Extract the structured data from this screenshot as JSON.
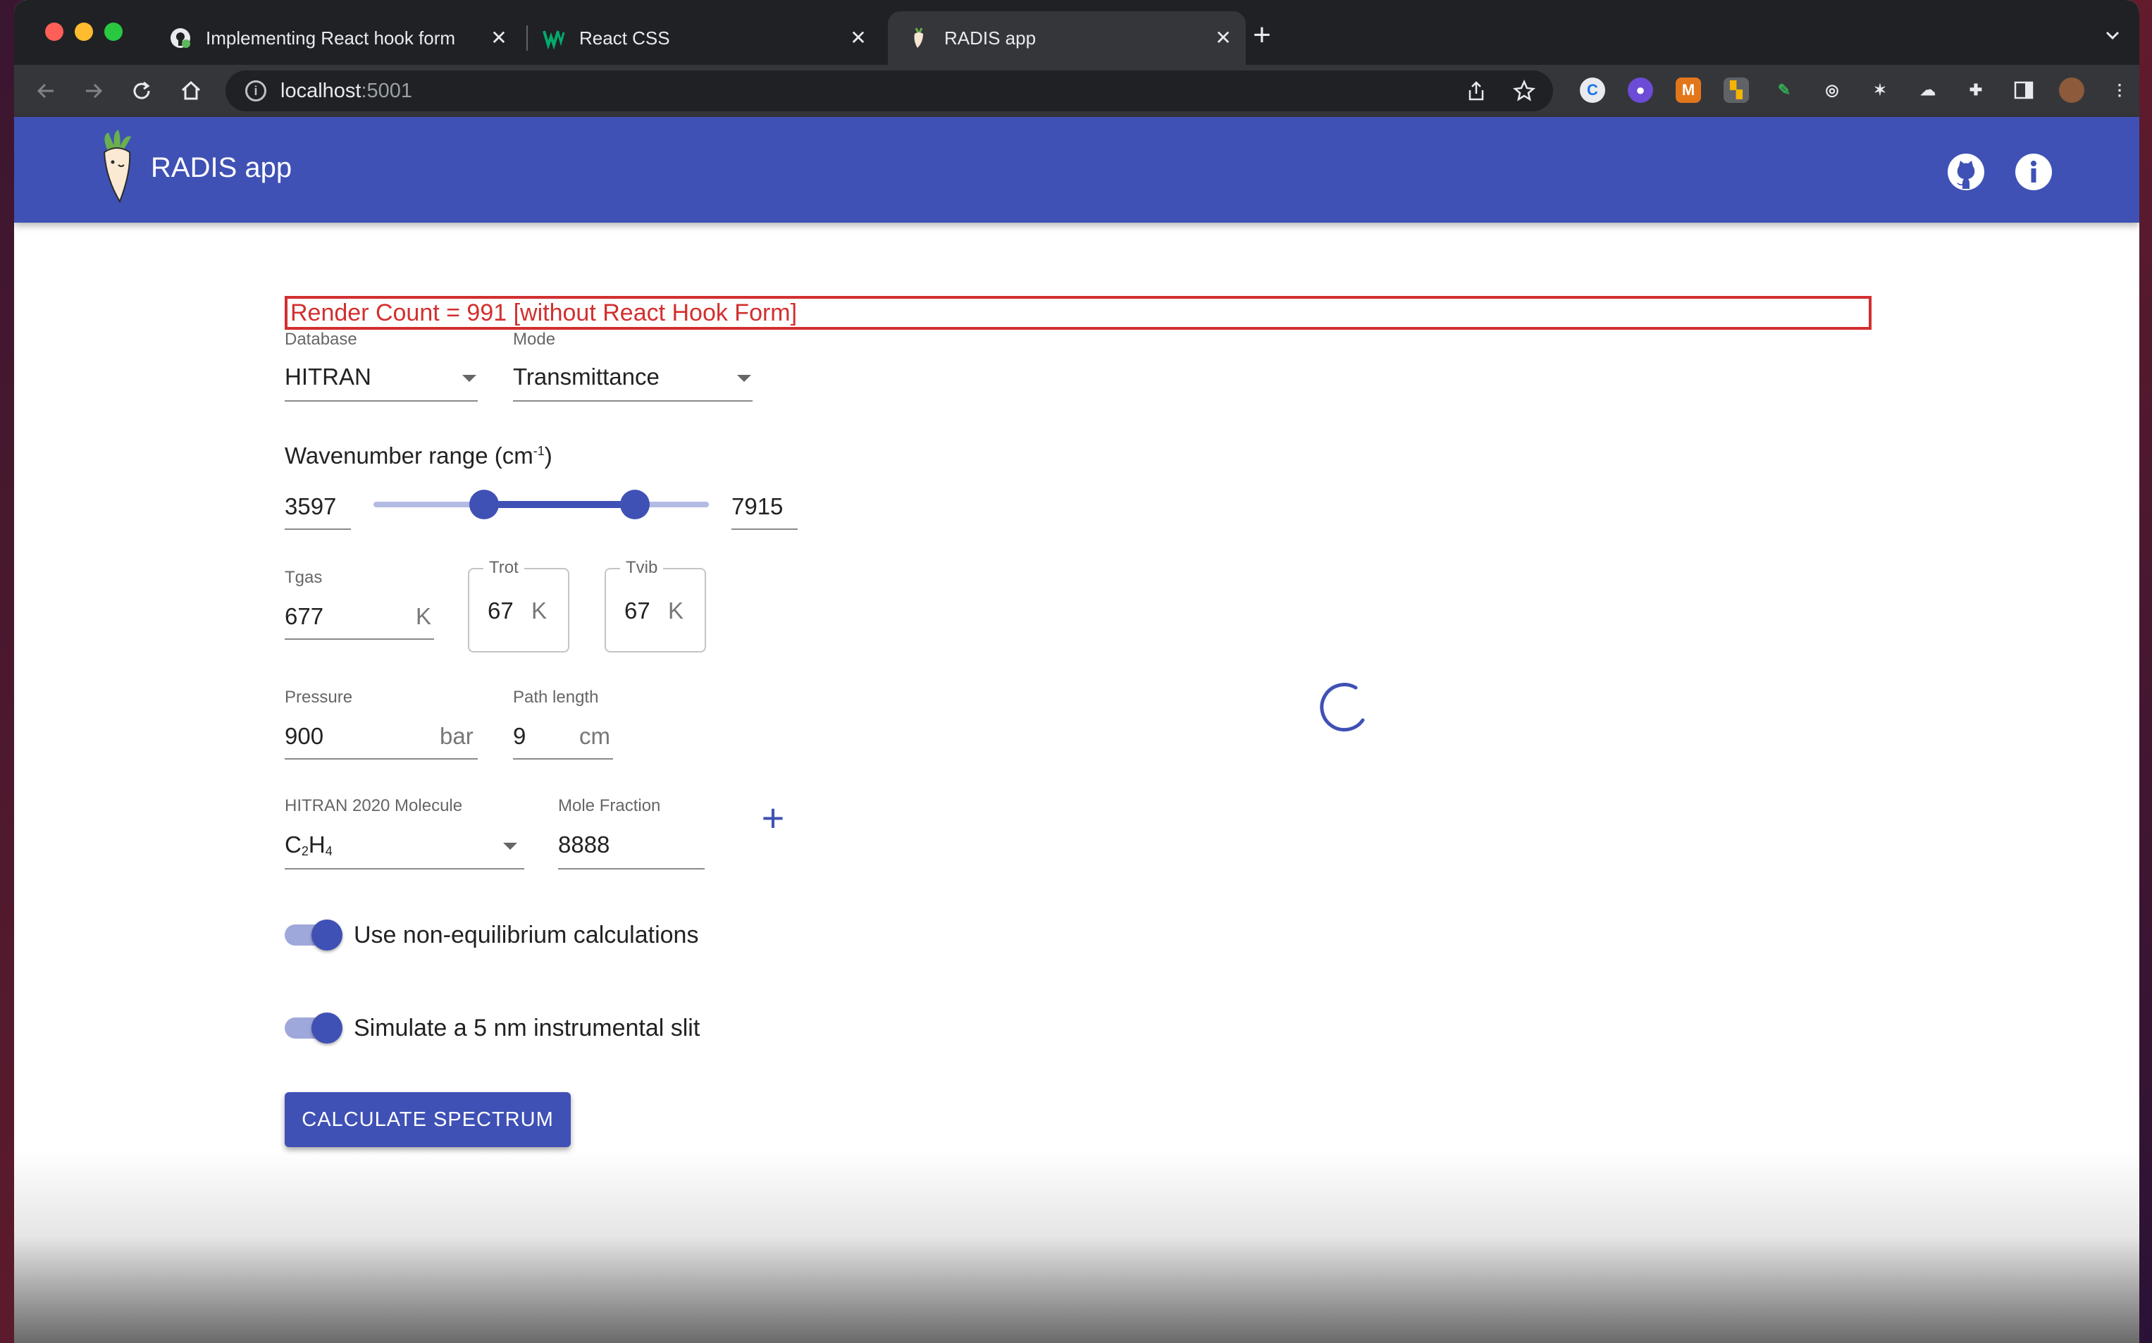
{
  "browser": {
    "tabs": [
      {
        "title": "Implementing React hook form",
        "favicon": "github-icon",
        "active": false
      },
      {
        "title": "React CSS",
        "favicon": "w3schools-icon",
        "active": false
      },
      {
        "title": "RADIS app",
        "favicon": "radish-icon",
        "active": true
      }
    ],
    "url_host": "localhost",
    "url_port": ":5001"
  },
  "app": {
    "title": "RADIS app",
    "header_icons": [
      "github-icon",
      "info-icon"
    ]
  },
  "render_count": "Render Count = 991 [without React Hook Form]",
  "database": {
    "label": "Database",
    "value": "HITRAN"
  },
  "mode": {
    "label": "Mode",
    "value": "Transmittance"
  },
  "wavenumber": {
    "title_prefix": "Wavenumber range (cm",
    "title_sup": "-1",
    "title_suffix": ")",
    "min": "3597",
    "max": "7915",
    "slider_low_fraction": 0.33,
    "slider_high_fraction": 0.78
  },
  "tgas": {
    "label": "Tgas",
    "value": "677",
    "unit": "K"
  },
  "trot": {
    "label": "Trot",
    "value": "67",
    "unit": "K"
  },
  "tvib": {
    "label": "Tvib",
    "value": "67",
    "unit": "K"
  },
  "pressure": {
    "label": "Pressure",
    "value": "900",
    "unit": "bar"
  },
  "path_length": {
    "label": "Path length",
    "value": "9",
    "unit": "cm"
  },
  "molecule": {
    "label": "HITRAN 2020 Molecule",
    "value_c": "C",
    "value_sub1": "2",
    "value_h": "H",
    "value_sub2": "4"
  },
  "mole_fraction": {
    "label": "Mole Fraction",
    "value": "8888"
  },
  "switches": {
    "non_equilibrium": {
      "label": "Use non-equilibrium calculations",
      "on": true
    },
    "slit": {
      "label": "Simulate a 5 nm instrumental slit",
      "on": true
    }
  },
  "calculate_button": "CALCULATE SPECTRUM",
  "colors": {
    "primary": "#3f51b5",
    "error": "#d32f2f",
    "primary_light": "#9fa8da"
  }
}
